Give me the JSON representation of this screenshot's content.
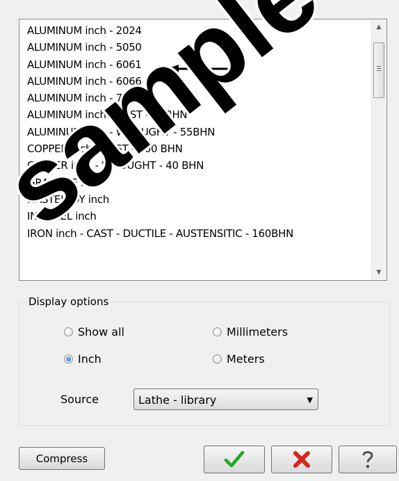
{
  "materials": [
    "ALUMINUM inch - 2024",
    "ALUMINUM inch - 5050",
    "ALUMINUM inch - 6061",
    "ALUMINUM inch - 6066",
    "ALUMINUM inch - 7075",
    "ALUMINUM inch - CAST - 65BHN",
    "ALUMINUM inch - WROUGHT - 55BHN",
    "COPPER inch - CAST - 100 BHN",
    "COPPER inch - WROUGHT - 40 BHN",
    "GRAPHITE inch",
    "HASTELLOY inch",
    "INCONEL inch",
    "IRON inch - CAST - DUCTILE - AUSTENSITIC - 160BHN"
  ],
  "display_options": {
    "legend": "Display options",
    "show_all": "Show all",
    "inch": "Inch",
    "millimeters": "Millimeters",
    "meters": "Meters",
    "selected": "Inch"
  },
  "source": {
    "label": "Source",
    "value": "Lathe - library"
  },
  "buttons": {
    "compress": "Compress"
  },
  "watermark": {
    "text": "sample not for"
  }
}
